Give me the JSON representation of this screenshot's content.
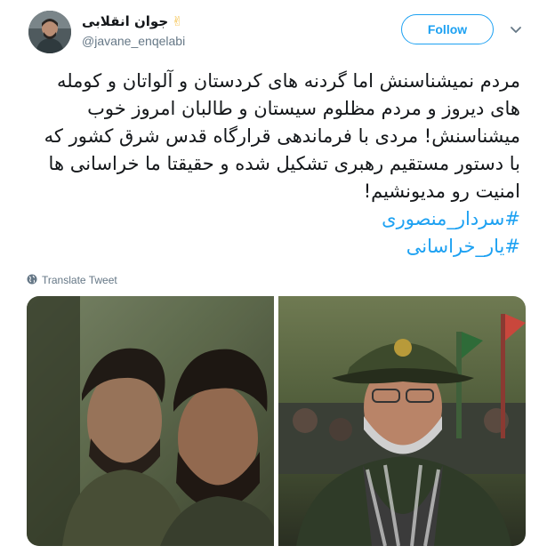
{
  "header": {
    "display_name": "جوان انقلابی",
    "name_emoji": "✌",
    "handle": "@javane_enqelabi",
    "follow_label": "Follow"
  },
  "tweet": {
    "lines": [
      "مردم نمیشناسنش اما گردنه های کردستان و آلواتان و کومله",
      "های دیروز و مردم مظلوم سیستان و طالبان امروز خوب",
      "میشناسنش! مردی با فرماندهی قرارگاه قدس شرق کشور که",
      "با دستور مستقیم رهبری تشکیل شده و حقیقتا ما خراسانی ها",
      "امنیت رو مدیونشیم!"
    ],
    "hashtags": [
      "#سردار_منصوری",
      "#یار_خراسانی"
    ],
    "translate_label": "Translate Tweet"
  },
  "media": {
    "photo_left": "old photo of two bearded young men",
    "photo_right": "man in military uniform and cap with checkered scarf"
  },
  "colors": {
    "accent": "#1da1f2",
    "text": "#14171a",
    "secondary": "#657786"
  },
  "icons": {
    "caret": "chevron-down-icon",
    "globe": "globe-icon",
    "emoji": "victory-hand-icon"
  }
}
